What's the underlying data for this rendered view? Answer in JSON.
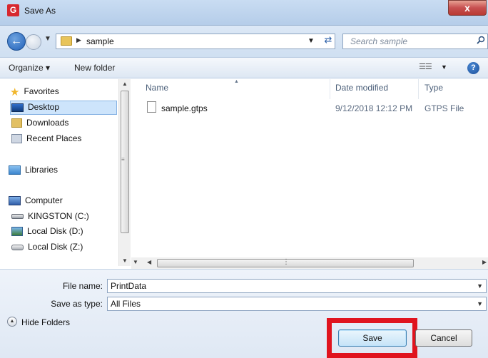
{
  "window": {
    "title": "Save As",
    "app_icon_letter": "G",
    "close_label": "x"
  },
  "nav": {
    "back_icon": "arrow-left",
    "forward_icon": "arrow-right",
    "address_path": "sample",
    "search_placeholder": "Search sample"
  },
  "toolbar": {
    "organize_label": "Organize ▾",
    "new_folder_label": "New folder",
    "help_label": "?"
  },
  "sidebar": {
    "favorites": "Favorites",
    "desktop": "Desktop",
    "downloads": "Downloads",
    "recent_places": "Recent Places",
    "libraries": "Libraries",
    "computer": "Computer",
    "drive_c": "KINGSTON (C:)",
    "drive_d": "Local Disk (D:)",
    "drive_z": "Local Disk (Z:)"
  },
  "filelist": {
    "columns": [
      "Name",
      "Date modified",
      "Type"
    ],
    "files": [
      {
        "name": "sample.gtps",
        "date": "9/12/2018 12:12 PM",
        "type": "GTPS File"
      }
    ]
  },
  "form": {
    "file_name_label": "File name:",
    "file_name_value": "PrintData",
    "save_type_label": "Save as type:",
    "save_type_value": "All Files"
  },
  "footer": {
    "hide_folders": "Hide Folders",
    "save": "Save",
    "cancel": "Cancel"
  },
  "colors": {
    "highlight_box": "#e0141e",
    "accent": "#3c7fb1"
  }
}
